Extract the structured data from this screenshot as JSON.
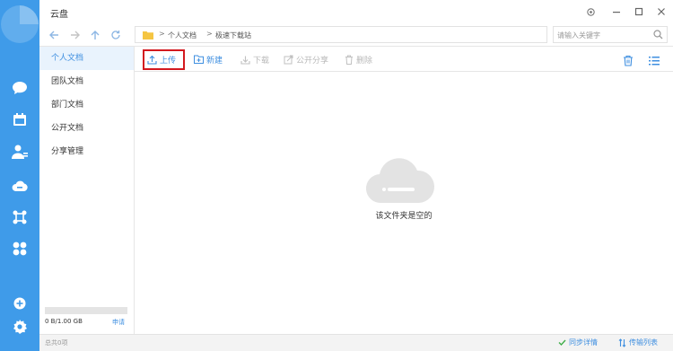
{
  "window": {
    "title": "云盘"
  },
  "search": {
    "placeholder": "请输入关键字"
  },
  "breadcrumb": [
    "个人文档",
    "极速下载站"
  ],
  "sidebar": {
    "items": [
      {
        "label": "个人文档",
        "active": true
      },
      {
        "label": "团队文档"
      },
      {
        "label": "部门文档"
      },
      {
        "label": "公开文档"
      },
      {
        "label": "分享管理"
      }
    ],
    "storage": {
      "used_text": "0 B/1.00 GB",
      "used_fraction": 0,
      "link": "申请"
    }
  },
  "toolbar": {
    "upload": "上传",
    "new": "新建",
    "download": "下载",
    "share": "公开分享",
    "delete": "删除"
  },
  "content": {
    "empty_text": "该文件夹是空的"
  },
  "statusbar": {
    "count": "总共0项",
    "sync": "同步详情",
    "transfer": "传输列表"
  },
  "colors": {
    "accent": "#3f9be9",
    "highlight": "#d3191f"
  }
}
